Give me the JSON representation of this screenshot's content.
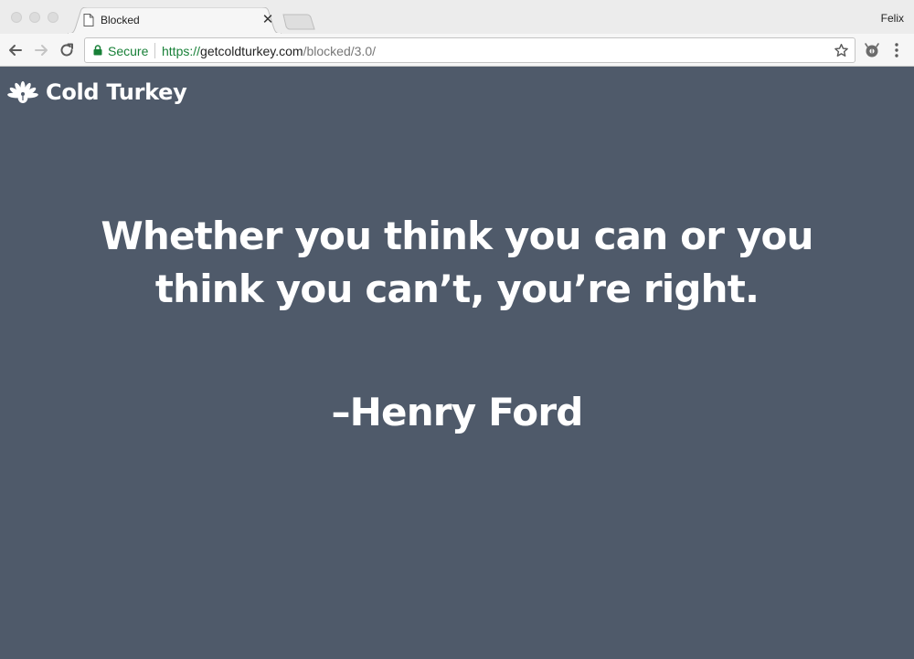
{
  "browser": {
    "tab": {
      "title": "Blocked",
      "close_glyph": "✕"
    },
    "profile_name": "Felix",
    "address_bar": {
      "secure_label": "Secure",
      "url_scheme": "https://",
      "url_host": "getcoldturkey.com",
      "url_path": "/blocked/3.0/"
    },
    "icons": {
      "back": "back-arrow-icon",
      "forward": "forward-arrow-icon",
      "reload": "reload-icon",
      "lock": "lock-icon",
      "bookmark": "star-icon",
      "extension": "extension-icon",
      "menu": "kebab-menu-icon"
    },
    "colors": {
      "secure_green": "#188038"
    }
  },
  "page": {
    "brand": {
      "name": "Cold Turkey",
      "logo": "turkey-logo-icon"
    },
    "quote": "Whether you think you can or you think you can’t, you’re right.",
    "author": "–Henry Ford",
    "colors": {
      "background": "#4f5a6a",
      "text": "#ffffff"
    }
  }
}
